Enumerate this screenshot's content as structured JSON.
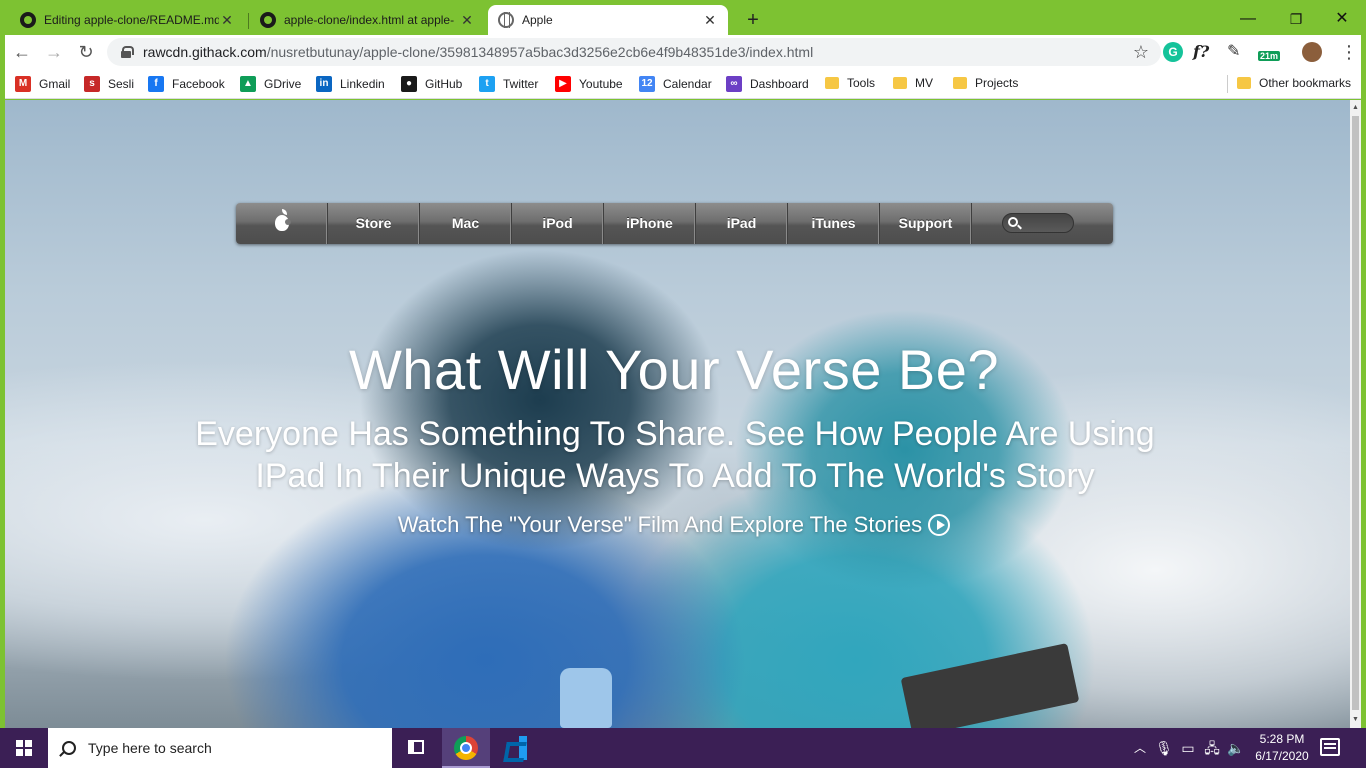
{
  "browser": {
    "tabs": [
      {
        "title": "Editing apple-clone/README.md",
        "icon": "github-icon",
        "active": false
      },
      {
        "title": "apple-clone/index.html at apple-",
        "icon": "github-icon",
        "active": false
      },
      {
        "title": "Apple",
        "icon": "globe-icon",
        "active": true
      }
    ],
    "new_tab": "+",
    "window_controls": {
      "minimize": "—",
      "restore": "❐",
      "close": "✕"
    },
    "address": {
      "host": "rawcdn.githack.com",
      "path": "/nusretbutunay/apple-clone/35981348957a5bac3d3256e2cb6e4f9b48351de3/index.html"
    },
    "extensions": {
      "grammarly": "G",
      "formula": "f?",
      "timer_badge": "21m"
    },
    "bookmarks": [
      {
        "label": "Gmail",
        "icon": "gmail-icon",
        "color": "#d93025",
        "glyph": "M"
      },
      {
        "label": "Sesli",
        "icon": "sesli-icon",
        "color": "#c62828",
        "glyph": "s"
      },
      {
        "label": "Facebook",
        "icon": "facebook-icon",
        "color": "#1877f2",
        "glyph": "f"
      },
      {
        "label": "GDrive",
        "icon": "gdrive-icon",
        "color": "#0f9d58",
        "glyph": "▲"
      },
      {
        "label": "Linkedin",
        "icon": "linkedin-icon",
        "color": "#0a66c2",
        "glyph": "in"
      },
      {
        "label": "GitHub",
        "icon": "github-icon",
        "color": "#1a1a1a",
        "glyph": "●"
      },
      {
        "label": "Twitter",
        "icon": "twitter-icon",
        "color": "#1da1f2",
        "glyph": "t"
      },
      {
        "label": "Youtube",
        "icon": "youtube-icon",
        "color": "#ff0000",
        "glyph": "▶"
      },
      {
        "label": "Calendar",
        "icon": "calendar-icon",
        "color": "#4285f4",
        "glyph": "12"
      },
      {
        "label": "Dashboard",
        "icon": "dashboard-icon",
        "color": "#6c3fc5",
        "glyph": "∞"
      },
      {
        "label": "Tools",
        "icon": "folder-icon",
        "folder": true
      },
      {
        "label": "MV",
        "icon": "folder-icon",
        "folder": true
      },
      {
        "label": "Projects",
        "icon": "folder-icon",
        "folder": true
      }
    ],
    "other_bookmarks": "Other bookmarks"
  },
  "site": {
    "nav": {
      "items": [
        "Store",
        "Mac",
        "iPod",
        "iPhone",
        "iPad",
        "iTunes",
        "Support"
      ]
    },
    "hero": {
      "title": "What Will Your Verse Be?",
      "subtitle": "Everyone Has Something To Share. See How People Are Using IPad In Their Unique Ways To Add To The World's Story",
      "cta": "Watch The \"Your Verse\" Film And Explore The Stories"
    }
  },
  "taskbar": {
    "search_placeholder": "Type here to search",
    "clock_time": "5:28 PM",
    "clock_date": "6/17/2020"
  },
  "colors": {
    "window_frame": "#7dc232",
    "taskbar": "#3b1f55",
    "nav_bar": "#6e6e6e"
  }
}
